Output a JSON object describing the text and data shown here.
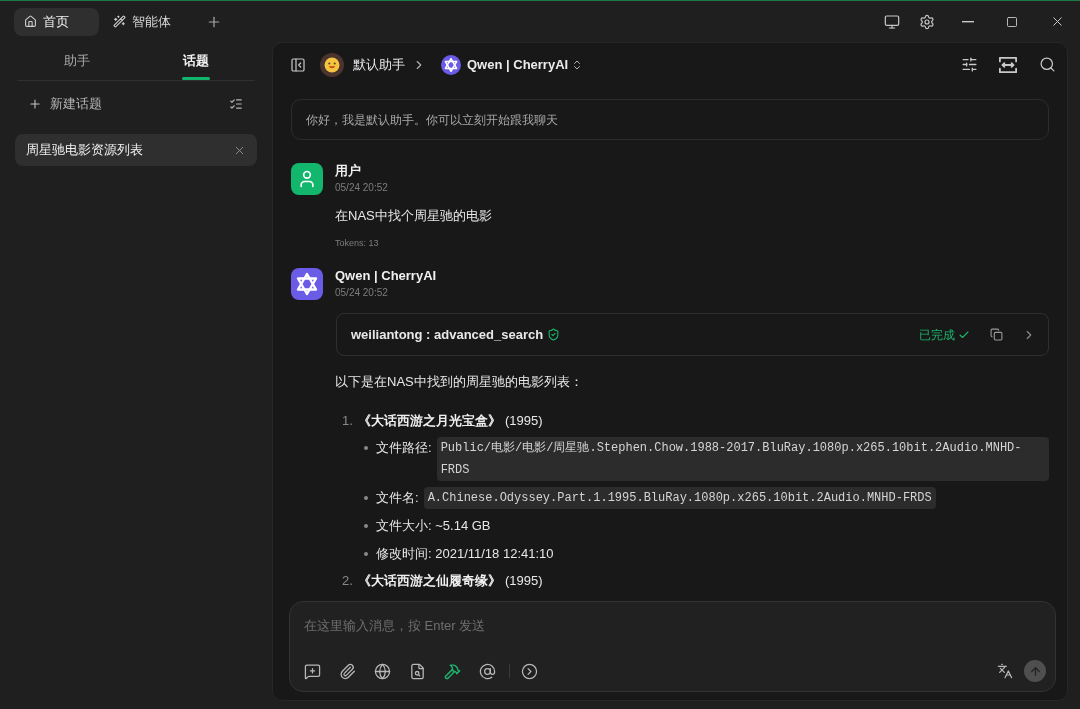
{
  "window": {
    "tabs": [
      {
        "label": "首页",
        "kind": "home",
        "selected": true
      },
      {
        "label": "智能体",
        "kind": "agents",
        "selected": false
      }
    ]
  },
  "sidebar": {
    "tabs": [
      {
        "label": "助手",
        "selected": false
      },
      {
        "label": "话题",
        "selected": true
      }
    ],
    "new_topic": "新建话题",
    "topics": [
      {
        "title": "周星驰电影资源列表",
        "selected": true
      }
    ]
  },
  "chat_header": {
    "assistant": "默认助手",
    "model": "Qwen | CherryAI"
  },
  "welcome": "你好，我是默认助手。你可以立刻开始跟我聊天",
  "messages": [
    {
      "kind": "user",
      "author": "用户",
      "time": "05/24 20:52",
      "text": "在NAS中找个周星驰的电影",
      "tokens": "Tokens: 13"
    },
    {
      "kind": "assistant",
      "author": "Qwen | CherryAI",
      "time": "05/24 20:52",
      "tool_call": {
        "name": "weiliantong : advanced_search",
        "status": "已完成"
      },
      "intro": "以下是在NAS中找到的周星驰的电影列表：",
      "movies": [
        {
          "number": "1.",
          "title": "《大话西游之月光宝盒》",
          "year": "(1995)",
          "details": [
            {
              "kind": "code",
              "label": "文件路径:",
              "value": "Public/电影/电影/周星驰.Stephen.Chow.1988-2017.BluRay.1080p.x265.10bit.2Audio.MNHD-FRDS"
            },
            {
              "kind": "code",
              "label": "文件名:",
              "value": "A.Chinese.Odyssey.Part.1.1995.BluRay.1080p.x265.10bit.2Audio.MNHD-FRDS"
            },
            {
              "kind": "text",
              "text": "文件大小: ~5.14 GB"
            },
            {
              "kind": "text",
              "text": "修改时间: 2021/11/18 12:41:10"
            }
          ]
        },
        {
          "number": "2.",
          "title": "《大话西游之仙履奇缘》",
          "year": "(1995)"
        }
      ]
    }
  ],
  "composer": {
    "placeholder": "在这里输入消息，按 Enter 发送",
    "mcp_enabled": true
  }
}
